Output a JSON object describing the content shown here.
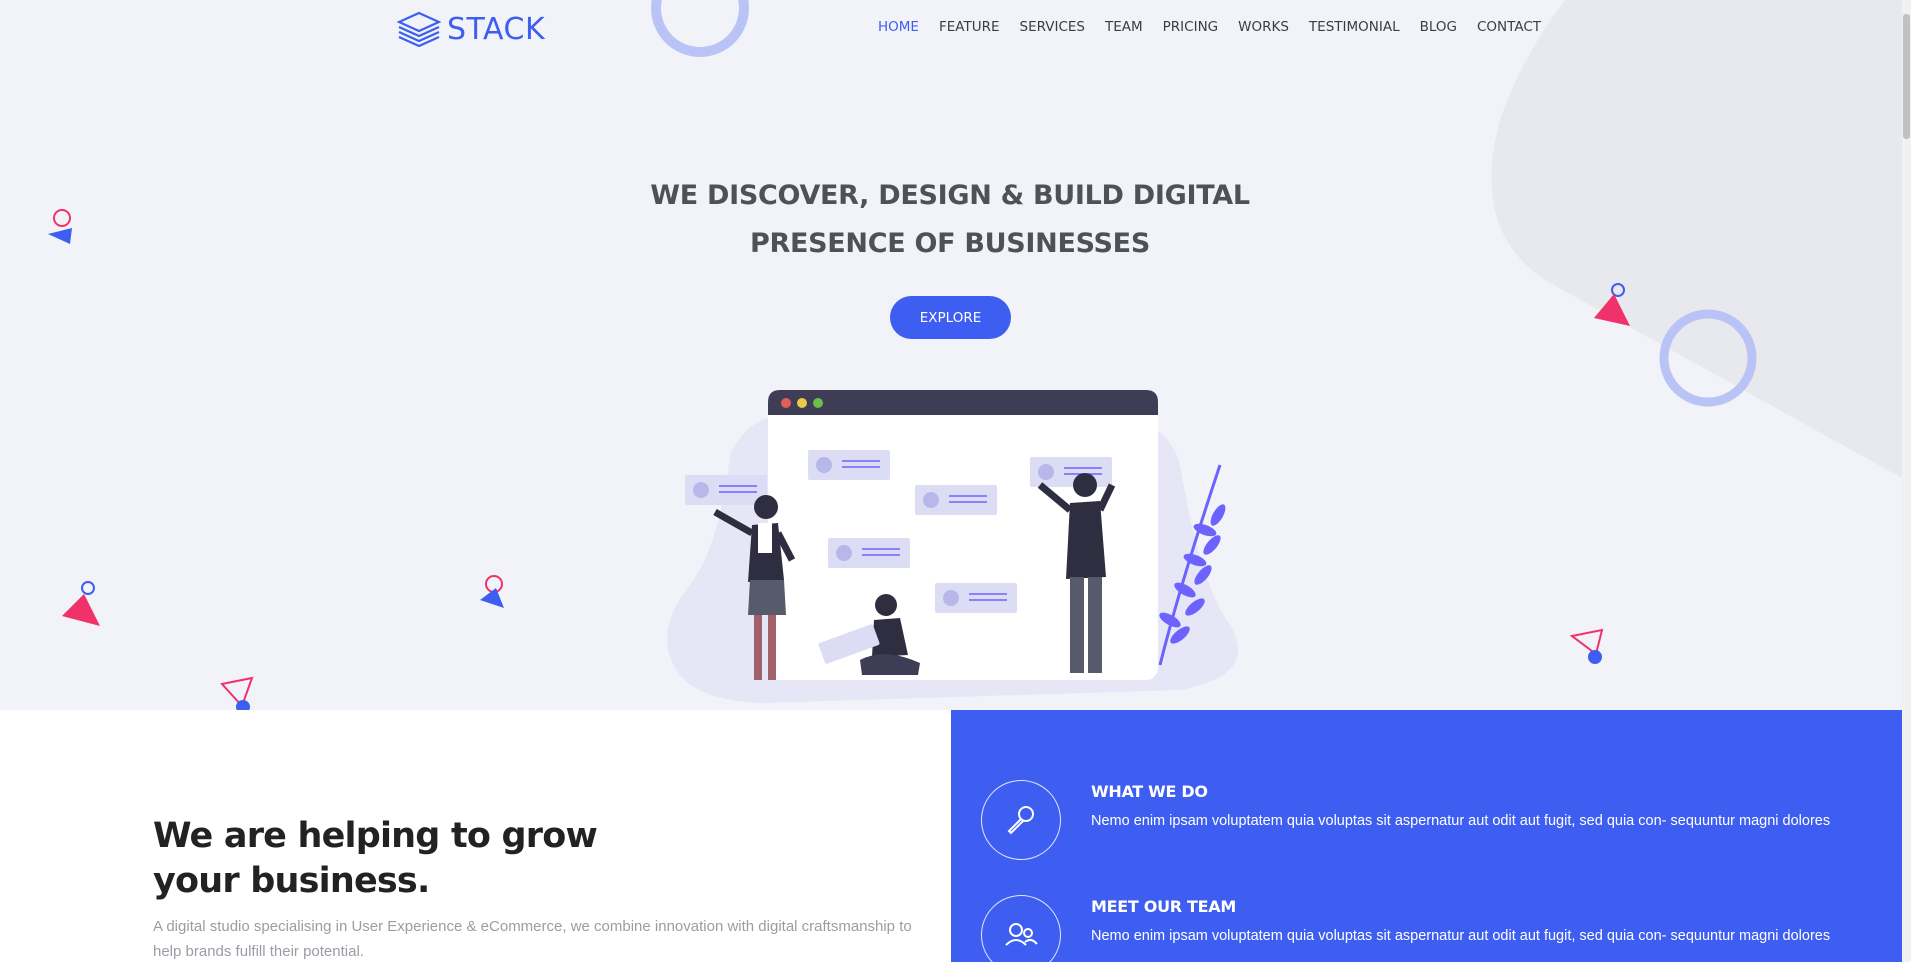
{
  "brand": {
    "name": "STACK",
    "color": "#3d5ef0"
  },
  "nav": {
    "items": [
      {
        "label": "HOME",
        "active": true
      },
      {
        "label": "FEATURE",
        "active": false
      },
      {
        "label": "SERVICES",
        "active": false
      },
      {
        "label": "TEAM",
        "active": false
      },
      {
        "label": "PRICING",
        "active": false
      },
      {
        "label": "WORKS",
        "active": false
      },
      {
        "label": "TESTIMONIAL",
        "active": false
      },
      {
        "label": "BLOG",
        "active": false
      },
      {
        "label": "CONTACT",
        "active": false
      }
    ]
  },
  "hero": {
    "title_line1": "WE DISCOVER, DESIGN & BUILD DIGITAL",
    "title_line2": "PRESENCE OF BUSINESSES",
    "cta_label": "EXPLORE"
  },
  "about": {
    "title_line1": "We are helping to grow",
    "title_line2": "your business.",
    "description": "A digital studio specialising in User Experience & eCommerce, we combine innovation with digital craftsmanship to help brands fulfill their potential."
  },
  "services": [
    {
      "title": "WHAT WE DO",
      "text": "Nemo enim ipsam voluptatem quia voluptas sit aspernatur aut odit aut fugit, sed quia con- sequuntur magni dolores",
      "icon": "microphone-icon"
    },
    {
      "title": "MEET OUR TEAM",
      "text": "Nemo enim ipsam voluptatem quia voluptas sit aspernatur aut odit aut fugit, sed quia con- sequuntur magni dolores",
      "icon": "team-icon"
    }
  ],
  "colors": {
    "accent": "#3d5ef0",
    "pink": "#f0316a",
    "hero_bg": "#f1f3f8"
  }
}
